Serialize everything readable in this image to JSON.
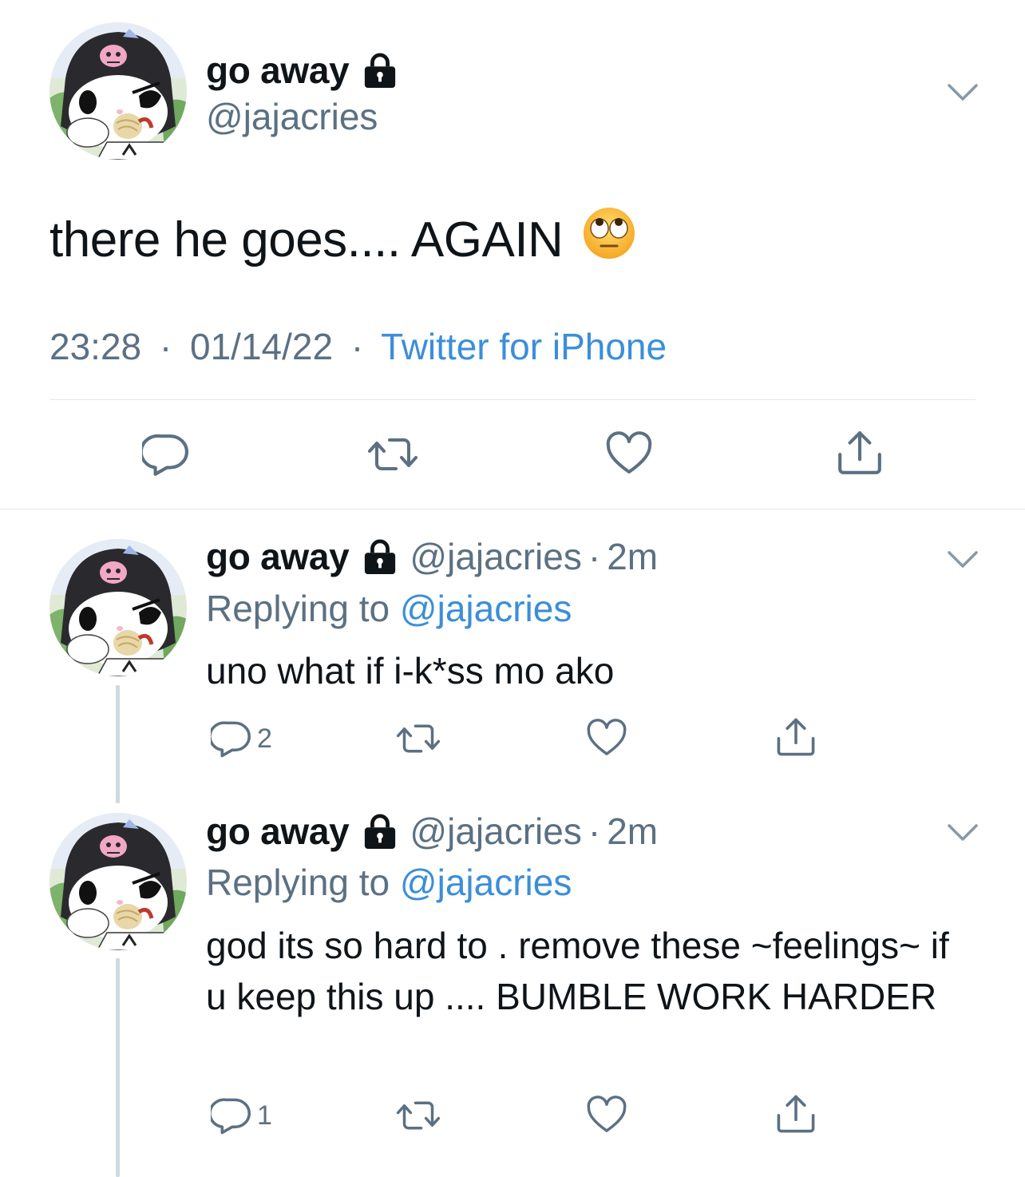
{
  "main_tweet": {
    "display_name": "go away",
    "handle": "@jajacries",
    "text": "there he goes.... AGAIN",
    "emoji": "face-with-rolling-eyes",
    "time": "23:28",
    "date": "01/14/22",
    "separator": "·",
    "source": "Twitter for iPhone"
  },
  "replies": [
    {
      "display_name": "go away",
      "handle": "@jajacries",
      "separator": "·",
      "time": "2m",
      "replying_prefix": "Replying to ",
      "replying_to": "@jajacries",
      "text": "uno what if i-k*ss mo ako",
      "reply_count": "2"
    },
    {
      "display_name": "go away",
      "handle": "@jajacries",
      "separator": "·",
      "time": "2m",
      "replying_prefix": "Replying to ",
      "replying_to": "@jajacries",
      "text": "god its so hard to . remove these ~feelings~ if u keep this up .... BUMBLE WORK HARDER",
      "reply_count": "1"
    }
  ],
  "colors": {
    "text": "#0f1419",
    "secondary": "#5b7083",
    "link": "#3b8ed9",
    "icon": "#5b7083",
    "divider": "#e1e8ed"
  },
  "icons": [
    "lock-icon",
    "chevron-down-icon",
    "reply-icon",
    "retweet-icon",
    "like-icon",
    "share-icon"
  ]
}
